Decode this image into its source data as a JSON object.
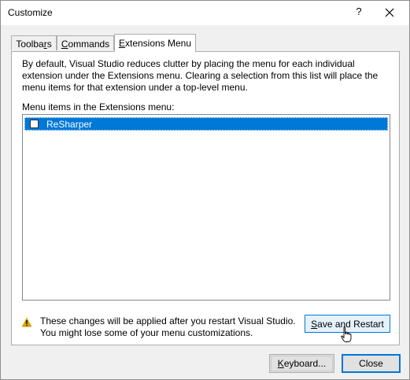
{
  "window": {
    "title": "Customize",
    "help_label": "?"
  },
  "tabs": [
    {
      "label_pre": "Toolba",
      "label_ul": "r",
      "label_post": "s"
    },
    {
      "label_pre": "",
      "label_ul": "C",
      "label_post": "ommands"
    },
    {
      "label_pre": "",
      "label_ul": "E",
      "label_post": "xtensions Menu"
    }
  ],
  "active_tab": "Extensions Menu",
  "description": "By default, Visual Studio reduces clutter by placing the menu for each individual extension under the Extensions menu. Clearing a selection from this list will place the menu items for that extension under a top-level menu.",
  "list": {
    "label": "Menu items in the Extensions menu:",
    "items": [
      {
        "label": "ReSharper",
        "checked": false,
        "selected": true
      }
    ]
  },
  "warning": {
    "line1": "These changes will be applied after you restart Visual Studio.",
    "line2": "You might lose some of your menu customizations."
  },
  "buttons": {
    "save_pre": "",
    "save_ul": "S",
    "save_post": "ave and Restart",
    "keyboard_pre": "",
    "keyboard_ul": "K",
    "keyboard_post": "eyboard...",
    "close": "Close"
  },
  "colors": {
    "accent": "#0078d7",
    "warning": "#d9a300"
  }
}
